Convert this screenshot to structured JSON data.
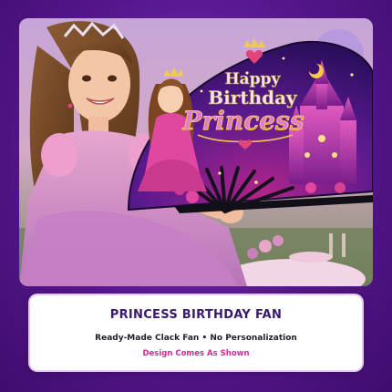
{
  "fan": {
    "line1": "Happy",
    "line2": "Birthday",
    "line3": "Princess"
  },
  "card": {
    "title": "PRINCESS BIRTHDAY FAN",
    "subtitle": "Ready-Made Clack Fan • No Personalization",
    "note": "Design Comes As Shown"
  },
  "colors": {
    "background": "#55168c",
    "title": "#3a1a6e",
    "note": "#d42a9a",
    "fan_gold": "#f2c94c",
    "fan_pink": "#e0479e"
  }
}
